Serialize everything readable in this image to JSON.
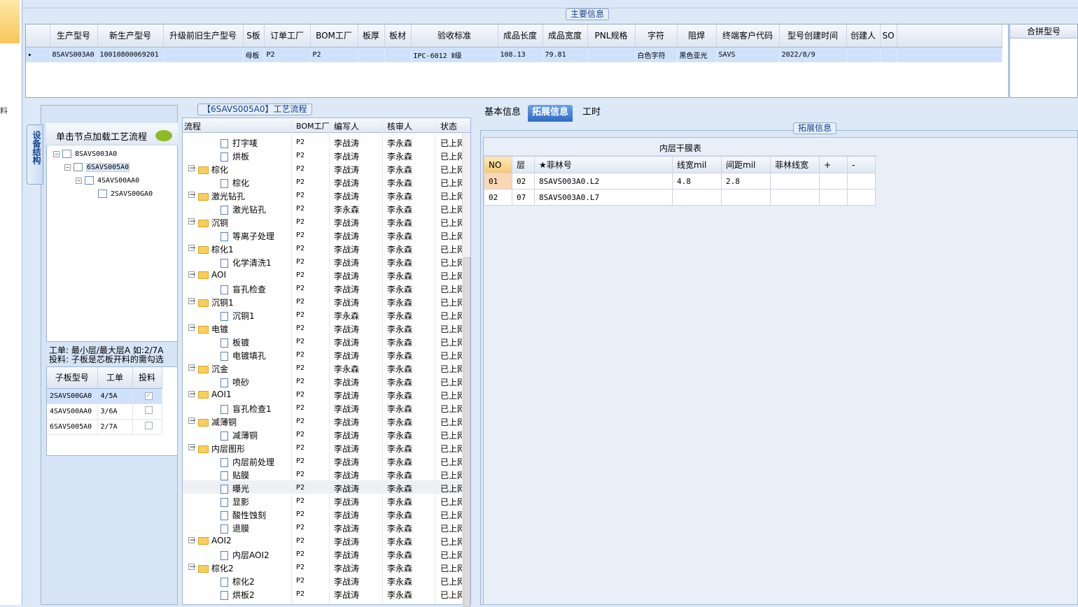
{
  "main_info": {
    "title": "主要信息",
    "columns": [
      "生产型号",
      "新生产型号",
      "升级前旧生产型号",
      "S板",
      "订单工厂",
      "BOM工厂",
      "板厚",
      "板材",
      "验收标准",
      "成品长度",
      "成品宽度",
      "PNL规格",
      "字符",
      "阻焊",
      "终端客户代码",
      "型号创建时间",
      "创建人",
      "SO"
    ],
    "row": {
      "生产型号": "8SAVS003A0",
      "新生产型号": "10010800069201",
      "升级前旧生产型号": "",
      "S板": "母板",
      "订单工厂": "P2",
      "BOM工厂": "P2",
      "板厚": "",
      "板材": "",
      "验收标准": "IPC-6012 Ⅱ级",
      "成品长度": "108.13",
      "成品宽度": "79.81",
      "PNL规格": "",
      "字符": "白色字符",
      "阻焊": "黑色亚光",
      "终端客户代码": "SAVS",
      "型号创建时间": "2022/8/9",
      "创建人": "",
      "SO": ""
    }
  },
  "merge_panel": {
    "title": "合拼型号"
  },
  "side_tab": {
    "label": "设备结构"
  },
  "left_tree": {
    "hint": "单击节点加载工艺流程",
    "nodes": [
      "8SAVS003A0",
      "6SAVS005A0",
      "4SAVS00AA0",
      "2SAVS00GA0"
    ],
    "note_line1": "工单: 最小层/最大层A 如:2/7A",
    "note_line2": "投料: 子板是芯板开料的需勾选"
  },
  "sub_board": {
    "columns": [
      "子板型号",
      "工单",
      "投料"
    ],
    "rows": [
      {
        "model": "2SAVS00GA0",
        "order": "4/5A",
        "checked": true
      },
      {
        "model": "4SAVS00AA0",
        "order": "3/6A",
        "checked": false
      },
      {
        "model": "6SAVS005A0",
        "order": "2/7A",
        "checked": false
      }
    ]
  },
  "flow": {
    "title": "【6SAVS005A0】工艺流程",
    "columns": [
      "流程",
      "BOM工厂",
      "编写人",
      "核审人",
      "状态"
    ],
    "rows": [
      {
        "kind": "doc",
        "name": "打字唛",
        "bom": "P2",
        "writer": "李战涛",
        "reviewer": "李永森",
        "status": "已上网"
      },
      {
        "kind": "doc",
        "name": "烘板",
        "bom": "P2",
        "writer": "李战涛",
        "reviewer": "李永森",
        "status": "已上网"
      },
      {
        "kind": "folder",
        "name": "棕化",
        "bom": "P2",
        "writer": "李战涛",
        "reviewer": "李永森",
        "status": "已上网"
      },
      {
        "kind": "doc",
        "name": "棕化",
        "bom": "P2",
        "writer": "李战涛",
        "reviewer": "李永森",
        "status": "已上网"
      },
      {
        "kind": "folder",
        "name": "激光钻孔",
        "bom": "P2",
        "writer": "李战涛",
        "reviewer": "李永森",
        "status": "已上网"
      },
      {
        "kind": "doc",
        "name": "激光钻孔",
        "bom": "P2",
        "writer": "李永森",
        "reviewer": "李永森",
        "status": "已上网"
      },
      {
        "kind": "folder",
        "name": "沉铜",
        "bom": "P2",
        "writer": "李战涛",
        "reviewer": "李永森",
        "status": "已上网"
      },
      {
        "kind": "doc",
        "name": "等离子处理",
        "bom": "P2",
        "writer": "李战涛",
        "reviewer": "李永森",
        "status": "已上网"
      },
      {
        "kind": "folder",
        "name": "棕化1",
        "bom": "P2",
        "writer": "李战涛",
        "reviewer": "李永森",
        "status": "已上网"
      },
      {
        "kind": "doc",
        "name": "化学清洗1",
        "bom": "P2",
        "writer": "李战涛",
        "reviewer": "李永森",
        "status": "已上网"
      },
      {
        "kind": "folder",
        "name": "AOI",
        "bom": "P2",
        "writer": "李战涛",
        "reviewer": "李永森",
        "status": "已上网"
      },
      {
        "kind": "doc",
        "name": "盲孔检查",
        "bom": "P2",
        "writer": "李战涛",
        "reviewer": "李永森",
        "status": "已上网"
      },
      {
        "kind": "folder",
        "name": "沉铜1",
        "bom": "P2",
        "writer": "李战涛",
        "reviewer": "李永森",
        "status": "已上网"
      },
      {
        "kind": "doc",
        "name": "沉铜1",
        "bom": "P2",
        "writer": "李永森",
        "reviewer": "李永森",
        "status": "已上网"
      },
      {
        "kind": "folder",
        "name": "电镀",
        "bom": "P2",
        "writer": "李战涛",
        "reviewer": "李永森",
        "status": "已上网"
      },
      {
        "kind": "doc",
        "name": "板镀",
        "bom": "P2",
        "writer": "李战涛",
        "reviewer": "李永森",
        "status": "已上网"
      },
      {
        "kind": "doc",
        "name": "电镀填孔",
        "bom": "P2",
        "writer": "李战涛",
        "reviewer": "李永森",
        "status": "已上网"
      },
      {
        "kind": "folder",
        "name": "沉金",
        "bom": "P2",
        "writer": "李永森",
        "reviewer": "李永森",
        "status": "已上网"
      },
      {
        "kind": "doc",
        "name": "喷砂",
        "bom": "P2",
        "writer": "李战涛",
        "reviewer": "李永森",
        "status": "已上网"
      },
      {
        "kind": "folder",
        "name": "AOI1",
        "bom": "P2",
        "writer": "李战涛",
        "reviewer": "李永森",
        "status": "已上网"
      },
      {
        "kind": "doc",
        "name": "盲孔检查1",
        "bom": "P2",
        "writer": "李战涛",
        "reviewer": "李永森",
        "status": "已上网"
      },
      {
        "kind": "folder",
        "name": "减薄铜",
        "bom": "P2",
        "writer": "李战涛",
        "reviewer": "李永森",
        "status": "已上网"
      },
      {
        "kind": "doc",
        "name": "减薄铜",
        "bom": "P2",
        "writer": "李战涛",
        "reviewer": "李永森",
        "status": "已上网"
      },
      {
        "kind": "folder",
        "name": "内层图形",
        "bom": "P2",
        "writer": "李战涛",
        "reviewer": "李永森",
        "status": "已上网"
      },
      {
        "kind": "doc",
        "name": "内层前处理",
        "bom": "P2",
        "writer": "李战涛",
        "reviewer": "李永森",
        "status": "已上网"
      },
      {
        "kind": "doc",
        "name": "贴膜",
        "bom": "P2",
        "writer": "李战涛",
        "reviewer": "李永森",
        "status": "已上网"
      },
      {
        "kind": "doc",
        "name": "曝光",
        "bom": "P2",
        "writer": "李战涛",
        "reviewer": "李永森",
        "status": "已上网"
      },
      {
        "kind": "doc",
        "name": "显影",
        "bom": "P2",
        "writer": "李战涛",
        "reviewer": "李永森",
        "status": "已上网"
      },
      {
        "kind": "doc",
        "name": "酸性蚀刻",
        "bom": "P2",
        "writer": "李战涛",
        "reviewer": "李永森",
        "status": "已上网"
      },
      {
        "kind": "doc",
        "name": "退膜",
        "bom": "P2",
        "writer": "李战涛",
        "reviewer": "李永森",
        "status": "已上网"
      },
      {
        "kind": "folder",
        "name": "AOI2",
        "bom": "P2",
        "writer": "李战涛",
        "reviewer": "李永森",
        "status": "已上网"
      },
      {
        "kind": "doc",
        "name": "内层AOI2",
        "bom": "P2",
        "writer": "李战涛",
        "reviewer": "李永森",
        "status": "已上网"
      },
      {
        "kind": "folder",
        "name": "棕化2",
        "bom": "P2",
        "writer": "李战涛",
        "reviewer": "李永森",
        "status": "已上网"
      },
      {
        "kind": "doc",
        "name": "棕化2",
        "bom": "P2",
        "writer": "李战涛",
        "reviewer": "李永森",
        "status": "已上网"
      },
      {
        "kind": "doc",
        "name": "烘板2",
        "bom": "P2",
        "writer": "李战涛",
        "reviewer": "李永森",
        "status": "已上网"
      }
    ]
  },
  "tabs": [
    "基本信息",
    "拓展信息",
    "工时"
  ],
  "active_tab": "拓展信息",
  "ext": {
    "title": "拓展信息",
    "film_table": {
      "caption": "内层干膜表",
      "columns": [
        "NO",
        "层",
        "★菲林号",
        "线宽mil",
        "间距mil",
        "菲林线宽",
        "+",
        "-"
      ],
      "rows": [
        [
          "01",
          "02",
          "8SAVS003A0.L2",
          "4.8",
          "2.8",
          "",
          "",
          ""
        ],
        [
          "02",
          "07",
          "8SAVS003A0.L7",
          "",
          "",
          "",
          "",
          ""
        ]
      ]
    }
  },
  "colors": {
    "selection": "#cfe2fb",
    "accent": "#2d6cc5",
    "folder": "#f7cf5a"
  }
}
